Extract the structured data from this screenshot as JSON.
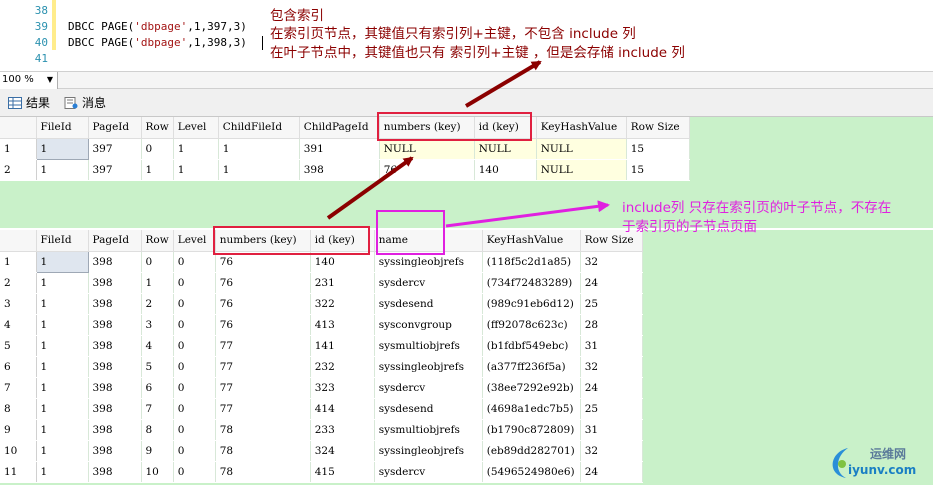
{
  "editor": {
    "line_numbers": [
      "38",
      "39",
      "40",
      "41"
    ],
    "line39_fn": "DBCC PAGE(",
    "line39_str": "'dbpage'",
    "line39_rest": ",1,397,3)",
    "line40_fn": "DBCC PAGE(",
    "line40_str": "'dbpage'",
    "line40_rest": ",1,398,3)",
    "note_line1": "包含索引",
    "note_line2": "在索引页节点，其键值只有索引列+主键，不包含 include 列",
    "note_line3": "在叶子节点中，其键值也只有 索引列+主键 ，但是会存储 include 列"
  },
  "zoom": {
    "value": "100 %"
  },
  "tabs": {
    "results": "结果",
    "messages": "消息"
  },
  "grid1": {
    "columns": [
      "FileId",
      "PageId",
      "Row",
      "Level",
      "ChildFileId",
      "ChildPageId",
      "numbers (key)",
      "id (key)",
      "KeyHashValue",
      "Row Size"
    ],
    "rows": [
      [
        "1",
        "1",
        "397",
        "0",
        "1",
        "1",
        "391",
        "NULL",
        "NULL",
        "NULL",
        "15"
      ],
      [
        "2",
        "1",
        "397",
        "1",
        "1",
        "1",
        "398",
        "76",
        "140",
        "NULL",
        "15"
      ]
    ]
  },
  "grid2": {
    "columns": [
      "FileId",
      "PageId",
      "Row",
      "Level",
      "numbers (key)",
      "id (key)",
      "name",
      "KeyHashValue",
      "Row Size"
    ],
    "rows": [
      [
        "1",
        "1",
        "398",
        "0",
        "0",
        "76",
        "140",
        "syssingleobjrefs",
        "(118f5c2d1a85)",
        "32"
      ],
      [
        "2",
        "1",
        "398",
        "1",
        "0",
        "76",
        "231",
        "sysdercv",
        "(734f72483289)",
        "24"
      ],
      [
        "3",
        "1",
        "398",
        "2",
        "0",
        "76",
        "322",
        "sysdesend",
        "(989c91eb6d12)",
        "25"
      ],
      [
        "4",
        "1",
        "398",
        "3",
        "0",
        "76",
        "413",
        "sysconvgroup",
        "(ff92078c623c)",
        "28"
      ],
      [
        "5",
        "1",
        "398",
        "4",
        "0",
        "77",
        "141",
        "sysmultiobjrefs",
        "(b1fdbf549ebc)",
        "31"
      ],
      [
        "6",
        "1",
        "398",
        "5",
        "0",
        "77",
        "232",
        "syssingleobjrefs",
        "(a377ff236f5a)",
        "32"
      ],
      [
        "7",
        "1",
        "398",
        "6",
        "0",
        "77",
        "323",
        "sysdercv",
        "(38ee7292e92b)",
        "24"
      ],
      [
        "8",
        "1",
        "398",
        "7",
        "0",
        "77",
        "414",
        "sysdesend",
        "(4698a1edc7b5)",
        "25"
      ],
      [
        "9",
        "1",
        "398",
        "8",
        "0",
        "78",
        "233",
        "sysmultiobjrefs",
        "(b1790c872809)",
        "31"
      ],
      [
        "10",
        "1",
        "398",
        "9",
        "0",
        "78",
        "324",
        "syssingleobjrefs",
        "(eb89dd282701)",
        "32"
      ],
      [
        "11",
        "1",
        "398",
        "10",
        "0",
        "78",
        "415",
        "sysdercv",
        "(5496524980e6)",
        "24"
      ]
    ]
  },
  "annotation": {
    "include_line1": "include列 只存在索引页的叶子节点，不存在",
    "include_line2": "于索引页的子节点页面"
  },
  "watermark": {
    "line1": "运维网",
    "line2": "iyunv.com"
  },
  "colors": {
    "grid_bg": "#c9f1c9",
    "red_box": "#e02040",
    "magenta": "#e020e0",
    "arrow": "#8b0000"
  }
}
